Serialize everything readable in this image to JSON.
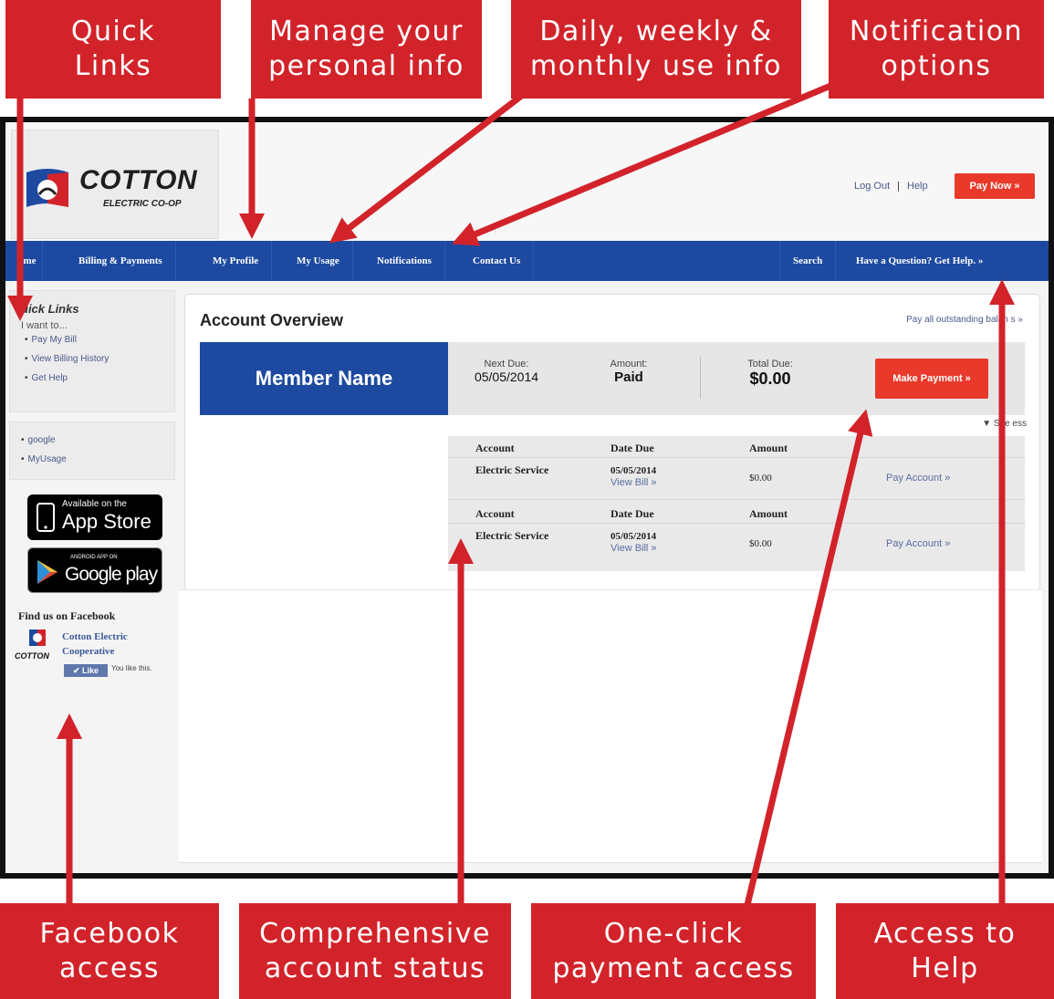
{
  "callouts": {
    "quick_links": "Quick\nLinks",
    "manage_info": "Manage your\npersonal info",
    "usage_info": "Daily, weekly &\nmonthly use info",
    "notification_options": "Notification\noptions",
    "facebook_access": "Facebook\naccess",
    "account_status": "Comprehensive\naccount status",
    "payment_access": "One-click\npayment access",
    "help_access": "Access to\nHelp"
  },
  "header": {
    "logo_text": "COTTON",
    "logo_sub": "ELECTRIC CO-OP",
    "logout": "Log Out",
    "separator": "|",
    "help": "Help",
    "pay_now": "Pay Now »"
  },
  "nav": {
    "home": "ome",
    "billing": "Billing & Payments",
    "profile": "My Profile",
    "usage": "My Usage",
    "notifications": "Notifications",
    "contact": "Contact Us",
    "search": "Search",
    "get_help": "Have a Question? Get Help. »"
  },
  "sidebar": {
    "quick_links_title": "uick Links",
    "want_to": "I want to...",
    "quick_links": [
      "Pay My Bill",
      "View Billing History",
      "Get Help"
    ],
    "other_links": [
      "google",
      "MyUsage"
    ],
    "app_store_small": "Available on the",
    "app_store_big": "App Store",
    "google_play_small": "ANDROID APP ON",
    "google_play_big": "Google play",
    "facebook_title": "Find us on Facebook",
    "facebook_page": "Cotton Electric Cooperative",
    "facebook_logo_text": "COTTON",
    "like_button": "Like",
    "like_text": "You like this."
  },
  "account": {
    "title": "Account Overview",
    "pay_all": "Pay all outstanding balan   s »",
    "member_name": "Member Name",
    "next_due_label": "Next Due:",
    "next_due_value": "05/05/2014",
    "amount_label": "Amount:",
    "amount_value": "Paid",
    "total_due_label": "Total Due:",
    "total_due_value": "$0.00",
    "make_payment": "Make Payment »",
    "see_less": "▼ See   ess"
  },
  "accounts_table": {
    "headers": [
      "Account",
      "Date Due",
      "Amount"
    ],
    "rows": [
      {
        "account": "Electric Service",
        "date_due": "05/05/2014",
        "view_bill": "View Bill »",
        "amount": "$0.00",
        "pay": "Pay Account »"
      },
      {
        "account": "Electric Service",
        "date_due": "05/05/2014",
        "view_bill": "View Bill »",
        "amount": "$0.00",
        "pay": "Pay Account »"
      }
    ]
  },
  "colors": {
    "callout_red": "#d2232a",
    "nav_blue": "#1d4aa0",
    "button_red": "#e8392b"
  }
}
